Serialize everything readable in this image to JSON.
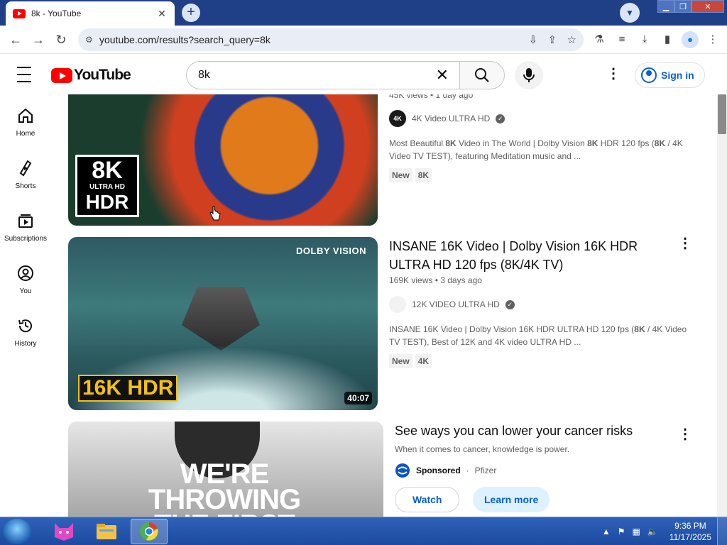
{
  "browser": {
    "tab_title": "8k - YouTube",
    "tab_close": "✕",
    "new_tab": "+",
    "url": "youtube.com/results?search_query=8k"
  },
  "youtube": {
    "logo_text": "YouTube",
    "search_query": "8k",
    "sign_in": "Sign in"
  },
  "rail": [
    {
      "label": "Home",
      "icon": "home-icon"
    },
    {
      "label": "Shorts",
      "icon": "shorts-icon"
    },
    {
      "label": "Subscriptions",
      "icon": "subscriptions-icon"
    },
    {
      "label": "You",
      "icon": "you-icon"
    },
    {
      "label": "History",
      "icon": "history-icon"
    }
  ],
  "results": [
    {
      "meta": "45K views • 1 day ago",
      "channel": "4K Video ULTRA HD",
      "channel_avatar_text": "4K",
      "desc_parts": [
        "Most Beautiful ",
        "8K",
        " Video in The World | Dolby Vision ",
        "8K",
        " HDR 120 fps (",
        "8K",
        " / 4K Video TV TEST), featuring Meditation music and ..."
      ],
      "badges": [
        "New",
        "8K"
      ],
      "overlay_lines": [
        "8K",
        "ULTRA HD",
        "HDR"
      ]
    },
    {
      "title": "INSANE 16K Video | Dolby Vision 16K HDR ULTRA HD 120 fps (8K/4K TV)",
      "meta": "169K views • 3 days ago",
      "channel": "12K VIDEO ULTRA HD",
      "desc_parts": [
        "INSANE 16K Video | Dolby Vision 16K HDR ULTRA HD 120 fps (",
        "8K",
        " / 4K Video TV TEST), Best of 12K and 4K video ULTRA HD ..."
      ],
      "badges": [
        "New",
        "4K"
      ],
      "overlay_brand": "DOLBY VISION",
      "overlay_big": "16K HDR",
      "duration": "40:07"
    },
    {
      "title": "See ways you can lower your cancer risks",
      "subtitle": "When it comes to cancer, knowledge is power.",
      "sponsored": "Sponsored",
      "advertiser": "Pfizer",
      "watch": "Watch",
      "learn_more": "Learn more",
      "overlay_text": "WE'RE THROWING THE FIRST"
    }
  ],
  "taskbar": {
    "time": "9:36 PM",
    "date": "11/17/2025"
  }
}
